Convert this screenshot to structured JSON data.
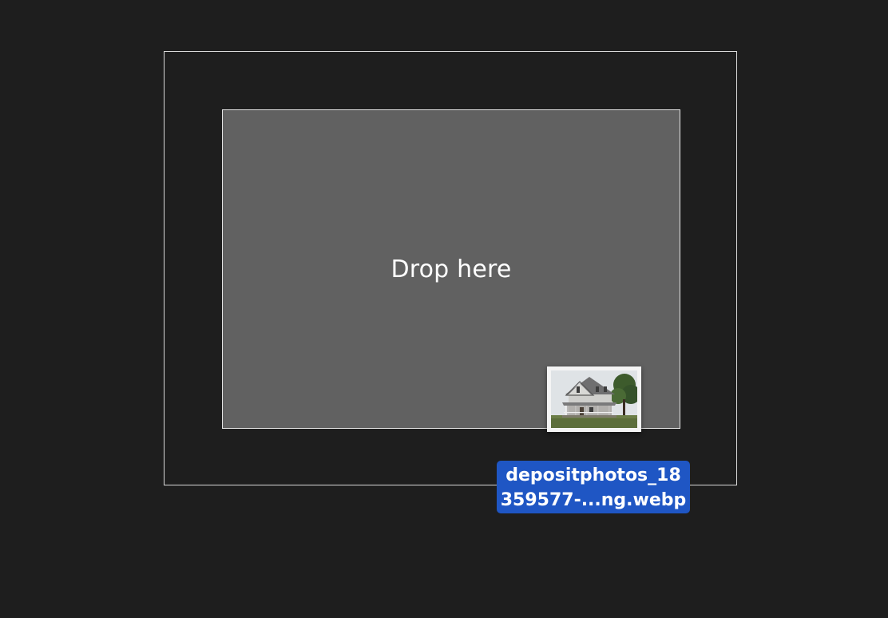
{
  "drop_zone": {
    "label": "Drop here"
  },
  "dragged_file": {
    "icon": "house-photo-thumbnail",
    "name_line_1": "depositphotos_18",
    "name_line_2": "359577-...ng.webp"
  },
  "colors": {
    "background": "#1e1e1e",
    "drop_zone_fill": "#616161",
    "file_label_highlight": "#1f56c4"
  }
}
